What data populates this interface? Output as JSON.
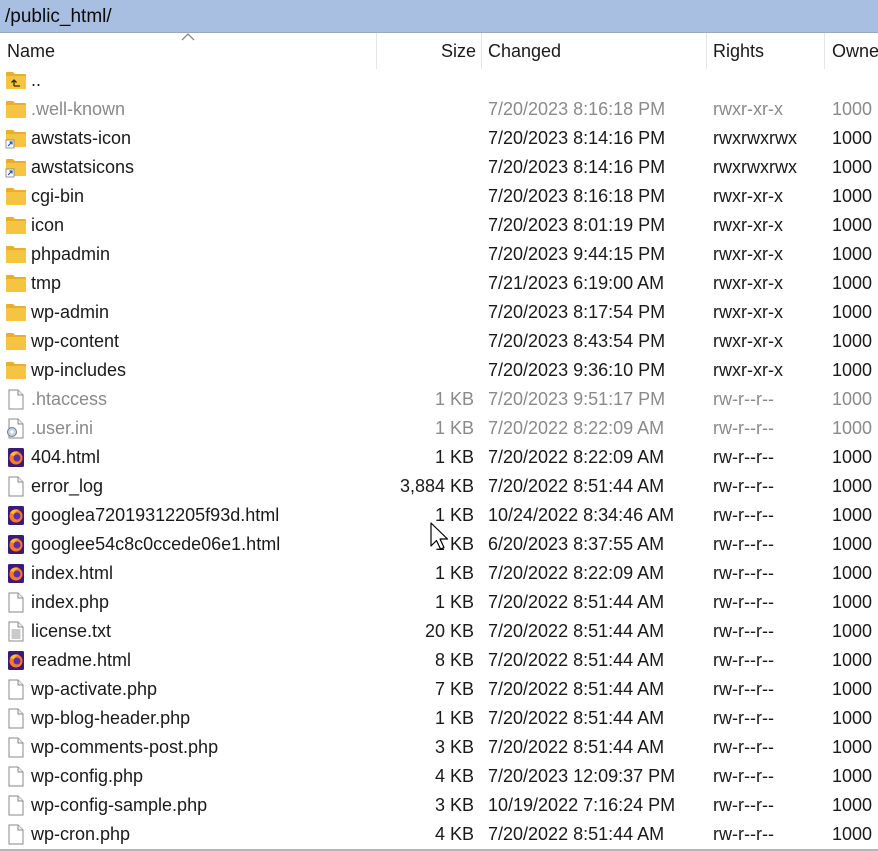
{
  "path": "/public_html/",
  "columns": {
    "name": "Name",
    "size": "Size",
    "changed": "Changed",
    "rights": "Rights",
    "owner": "Owne"
  },
  "colors": {
    "path_bar": "#a9bfe2",
    "folder": "#f5c542",
    "dim_text": "#8a8a8a",
    "firefox_purple": "#5b2fb0",
    "firefox_orange": "#ff7a1a"
  },
  "files": [
    {
      "name": "..",
      "size": "",
      "changed": "",
      "rights": "",
      "owner": "",
      "icon": "parent-folder-icon",
      "dim": false
    },
    {
      "name": ".well-known",
      "size": "",
      "changed": "7/20/2023 8:16:18 PM",
      "rights": "rwxr-xr-x",
      "owner": "1000",
      "icon": "folder-icon",
      "dim": true
    },
    {
      "name": "awstats-icon",
      "size": "",
      "changed": "7/20/2023 8:14:16 PM",
      "rights": "rwxrwxrwx",
      "owner": "1000",
      "icon": "folder-shortcut-icon",
      "dim": false
    },
    {
      "name": "awstatsicons",
      "size": "",
      "changed": "7/20/2023 8:14:16 PM",
      "rights": "rwxrwxrwx",
      "owner": "1000",
      "icon": "folder-shortcut-icon",
      "dim": false
    },
    {
      "name": "cgi-bin",
      "size": "",
      "changed": "7/20/2023 8:16:18 PM",
      "rights": "rwxr-xr-x",
      "owner": "1000",
      "icon": "folder-icon",
      "dim": false
    },
    {
      "name": "icon",
      "size": "",
      "changed": "7/20/2023 8:01:19 PM",
      "rights": "rwxr-xr-x",
      "owner": "1000",
      "icon": "folder-icon",
      "dim": false
    },
    {
      "name": "phpadmin",
      "size": "",
      "changed": "7/20/2023 9:44:15 PM",
      "rights": "rwxr-xr-x",
      "owner": "1000",
      "icon": "folder-icon",
      "dim": false
    },
    {
      "name": "tmp",
      "size": "",
      "changed": "7/21/2023 6:19:00 AM",
      "rights": "rwxr-xr-x",
      "owner": "1000",
      "icon": "folder-icon",
      "dim": false
    },
    {
      "name": "wp-admin",
      "size": "",
      "changed": "7/20/2023 8:17:54 PM",
      "rights": "rwxr-xr-x",
      "owner": "1000",
      "icon": "folder-icon",
      "dim": false
    },
    {
      "name": "wp-content",
      "size": "",
      "changed": "7/20/2023 8:43:54 PM",
      "rights": "rwxr-xr-x",
      "owner": "1000",
      "icon": "folder-icon",
      "dim": false
    },
    {
      "name": "wp-includes",
      "size": "",
      "changed": "7/20/2023 9:36:10 PM",
      "rights": "rwxr-xr-x",
      "owner": "1000",
      "icon": "folder-icon",
      "dim": false
    },
    {
      "name": ".htaccess",
      "size": "1 KB",
      "changed": "7/20/2023 9:51:17 PM",
      "rights": "rw-r--r--",
      "owner": "1000",
      "icon": "file-icon",
      "dim": true
    },
    {
      "name": ".user.ini",
      "size": "1 KB",
      "changed": "7/20/2022 8:22:09 AM",
      "rights": "rw-r--r--",
      "owner": "1000",
      "icon": "settings-file-icon",
      "dim": true
    },
    {
      "name": "404.html",
      "size": "1 KB",
      "changed": "7/20/2022 8:22:09 AM",
      "rights": "rw-r--r--",
      "owner": "1000",
      "icon": "firefox-html-icon",
      "dim": false
    },
    {
      "name": "error_log",
      "size": "3,884 KB",
      "changed": "7/20/2022 8:51:44 AM",
      "rights": "rw-r--r--",
      "owner": "1000",
      "icon": "file-icon",
      "dim": false
    },
    {
      "name": "googlea72019312205f93d.html",
      "size": "1 KB",
      "changed": "10/24/2022 8:34:46 AM",
      "rights": "rw-r--r--",
      "owner": "1000",
      "icon": "firefox-html-icon",
      "dim": false
    },
    {
      "name": "googlee54c8c0ccede06e1.html",
      "size": "1 KB",
      "changed": "6/20/2023 8:37:55 AM",
      "rights": "rw-r--r--",
      "owner": "1000",
      "icon": "firefox-html-icon",
      "dim": false
    },
    {
      "name": "index.html",
      "size": "1 KB",
      "changed": "7/20/2022 8:22:09 AM",
      "rights": "rw-r--r--",
      "owner": "1000",
      "icon": "firefox-html-icon",
      "dim": false
    },
    {
      "name": "index.php",
      "size": "1 KB",
      "changed": "7/20/2022 8:51:44 AM",
      "rights": "rw-r--r--",
      "owner": "1000",
      "icon": "file-icon",
      "dim": false
    },
    {
      "name": "license.txt",
      "size": "20 KB",
      "changed": "7/20/2022 8:51:44 AM",
      "rights": "rw-r--r--",
      "owner": "1000",
      "icon": "text-file-icon",
      "dim": false
    },
    {
      "name": "readme.html",
      "size": "8 KB",
      "changed": "7/20/2022 8:51:44 AM",
      "rights": "rw-r--r--",
      "owner": "1000",
      "icon": "firefox-html-icon",
      "dim": false
    },
    {
      "name": "wp-activate.php",
      "size": "7 KB",
      "changed": "7/20/2022 8:51:44 AM",
      "rights": "rw-r--r--",
      "owner": "1000",
      "icon": "file-icon",
      "dim": false
    },
    {
      "name": "wp-blog-header.php",
      "size": "1 KB",
      "changed": "7/20/2022 8:51:44 AM",
      "rights": "rw-r--r--",
      "owner": "1000",
      "icon": "file-icon",
      "dim": false
    },
    {
      "name": "wp-comments-post.php",
      "size": "3 KB",
      "changed": "7/20/2022 8:51:44 AM",
      "rights": "rw-r--r--",
      "owner": "1000",
      "icon": "file-icon",
      "dim": false
    },
    {
      "name": "wp-config.php",
      "size": "4 KB",
      "changed": "7/20/2023 12:09:37 PM",
      "rights": "rw-r--r--",
      "owner": "1000",
      "icon": "file-icon",
      "dim": false
    },
    {
      "name": "wp-config-sample.php",
      "size": "3 KB",
      "changed": "10/19/2022 7:16:24 PM",
      "rights": "rw-r--r--",
      "owner": "1000",
      "icon": "file-icon",
      "dim": false
    },
    {
      "name": "wp-cron.php",
      "size": "4 KB",
      "changed": "7/20/2022 8:51:44 AM",
      "rights": "rw-r--r--",
      "owner": "1000",
      "icon": "file-icon",
      "dim": false
    }
  ]
}
